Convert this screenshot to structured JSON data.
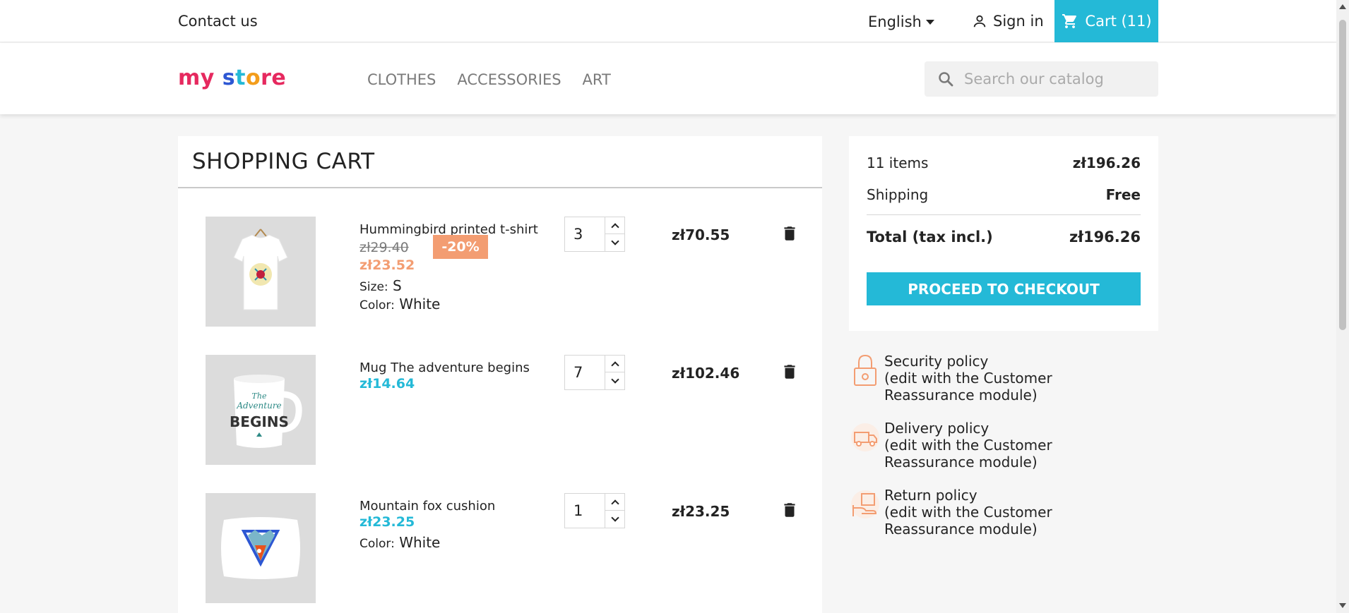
{
  "topbar": {
    "contact_label": "Contact us",
    "language": "English",
    "signin_label": "Sign in",
    "cart_label": "Cart (11)"
  },
  "header": {
    "logo": {
      "part1": "my",
      "part2": "s",
      "part3": "t",
      "part4": "o",
      "part5": "re"
    },
    "menu": [
      "CLOTHES",
      "ACCESSORIES",
      "ART"
    ],
    "search_placeholder": "Search our catalog"
  },
  "cart": {
    "title": "SHOPPING CART",
    "items": [
      {
        "name": "Hummingbird printed t-shirt",
        "old_price": "zł29.40",
        "discount": "-20%",
        "price": "zł23.52",
        "attrs": [
          {
            "label": "Size:",
            "value": "S"
          },
          {
            "label": "Color:",
            "value": "White"
          }
        ],
        "quantity": "3",
        "total": "zł70.55"
      },
      {
        "name": "Mug The adventure begins",
        "price": "zł14.64",
        "quantity": "7",
        "total": "zł102.46"
      },
      {
        "name": "Mountain fox cushion",
        "price": "zł23.25",
        "attrs": [
          {
            "label": "Color:",
            "value": "White"
          }
        ],
        "quantity": "1",
        "total": "zł23.25"
      }
    ]
  },
  "summary": {
    "items_label": "11 items",
    "items_value": "zł196.26",
    "shipping_label": "Shipping",
    "shipping_value": "Free",
    "total_label": "Total (tax incl.)",
    "total_value": "zł196.26",
    "checkout_label": "PROCEED TO CHECKOUT"
  },
  "reassurance": [
    {
      "title": "Security policy",
      "desc": "(edit with the Customer Reassurance module)"
    },
    {
      "title": "Delivery policy",
      "desc": "(edit with the Customer Reassurance module)"
    },
    {
      "title": "Return policy",
      "desc": "(edit with the Customer Reassurance module)"
    }
  ],
  "colors": {
    "accent": "#24b9d7",
    "discount": "#f39d72"
  },
  "icons": {
    "user": "user-icon",
    "cart": "cart-icon",
    "search": "search-icon",
    "trash": "trash-icon",
    "lock": "lock-icon",
    "truck": "truck-icon",
    "return": "return-box-icon"
  }
}
